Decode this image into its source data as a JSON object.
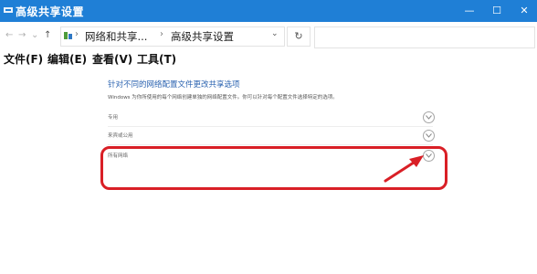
{
  "window": {
    "title": "高级共享设置",
    "min": "—",
    "max": "☐",
    "close": "✕"
  },
  "nav": {
    "back": "←",
    "forward": "→",
    "recent": "⌄",
    "up": "↑"
  },
  "breadcrumb": {
    "items": [
      "网络和共享...",
      "高级共享设置"
    ],
    "separator": "›",
    "dropdown": "⌄",
    "refresh": "↻"
  },
  "search": {
    "placeholder": ""
  },
  "menu": {
    "items": [
      "文件(F)",
      "编辑(E)",
      "查看(V)",
      "工具(T)"
    ]
  },
  "main": {
    "heading": "针对不同的网络配置文件更改共享选项",
    "description": "Windows 为你所使用的每个网络创建单独的网络配置文件。你可以针对每个配置文件选择特定的选项。",
    "sections": [
      {
        "label": "专用"
      },
      {
        "label": "来宾或公用"
      },
      {
        "label": "所有网络"
      }
    ]
  },
  "colors": {
    "titlebar": "#1f7fd6",
    "heading": "#2b63b0",
    "highlight": "#d91f26"
  },
  "icons": [
    "network-app-icon",
    "folder-icon",
    "chevron-down-icon",
    "refresh-icon",
    "red-arrow"
  ]
}
